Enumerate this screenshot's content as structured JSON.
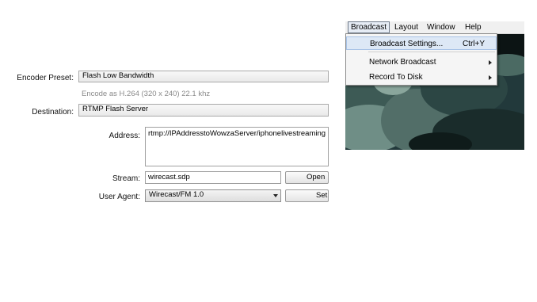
{
  "settings": {
    "encoder_preset_label": "Encoder Preset:",
    "encoder_preset_value": "Flash Low Bandwidth",
    "encode_hint": "Encode as H.264 (320 x 240) 22.1 khz",
    "destination_label": "Destination:",
    "destination_value": "RTMP Flash Server",
    "address_label": "Address:",
    "address_value": "rtmp://IPAddresstoWowzaServer/iphonelivestreaming",
    "stream_label": "Stream:",
    "stream_value": "wirecast.sdp",
    "open_button": "Open",
    "user_agent_label": "User Agent:",
    "user_agent_value": "Wirecast/FM 1.0",
    "set_button": "Set"
  },
  "menubar": {
    "items": [
      "Broadcast",
      "Layout",
      "Window",
      "Help"
    ]
  },
  "broadcast_menu": {
    "items": [
      {
        "label": "Broadcast Settings...",
        "shortcut": "Ctrl+Y"
      },
      {
        "label": "Network Broadcast",
        "shortcut": ""
      },
      {
        "label": "Record To Disk",
        "shortcut": ""
      }
    ]
  },
  "colors": {
    "menu_highlight": "#dde8f6",
    "video_dark": "#1b2a2d"
  }
}
